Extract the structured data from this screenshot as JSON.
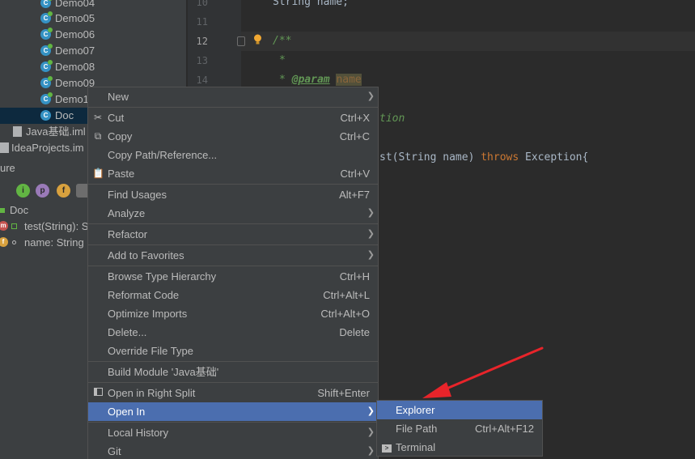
{
  "project_tree": {
    "items": [
      {
        "label": "Demo04",
        "type": "class"
      },
      {
        "label": "Demo05",
        "type": "class"
      },
      {
        "label": "Demo06",
        "type": "class"
      },
      {
        "label": "Demo07",
        "type": "class"
      },
      {
        "label": "Demo08",
        "type": "class"
      },
      {
        "label": "Demo09",
        "type": "class"
      },
      {
        "label": "Demo1",
        "type": "class"
      },
      {
        "label": "Doc",
        "type": "class"
      },
      {
        "label": "Java基础.iml",
        "type": "file"
      },
      {
        "label": "IdeaProjects.im",
        "type": "file"
      }
    ]
  },
  "structure": {
    "header": "ure",
    "root": "Doc",
    "members": [
      {
        "badge": "m",
        "label": "test(String): S"
      },
      {
        "badge": "f",
        "label": "name: String"
      }
    ],
    "toolbar_icons": [
      "i",
      "p",
      "f"
    ]
  },
  "editor": {
    "lines": [
      {
        "num": "10",
        "code": "String name;"
      },
      {
        "num": "11",
        "code": ""
      },
      {
        "num": "12",
        "code": "/**"
      },
      {
        "num": "13",
        "code": "*"
      },
      {
        "num": "14",
        "code_tag": "@param",
        "code_param": "name"
      }
    ],
    "fragment_exception": "tion",
    "fragment_method_prefix": "st(String name) ",
    "fragment_throws": "throws",
    "fragment_method_suffix": " Exception{"
  },
  "context_menu": {
    "items": [
      {
        "label": "New",
        "shortcut": "",
        "submenu": true
      },
      {
        "label": "Cut",
        "shortcut": "Ctrl+X",
        "icon": "scissors-icon"
      },
      {
        "label": "Copy",
        "shortcut": "Ctrl+C",
        "icon": "copy-icon"
      },
      {
        "label": "Copy Path/Reference...",
        "shortcut": ""
      },
      {
        "label": "Paste",
        "shortcut": "Ctrl+V",
        "icon": "paste-icon"
      },
      {
        "label": "Find Usages",
        "shortcut": "Alt+F7"
      },
      {
        "label": "Analyze",
        "shortcut": "",
        "submenu": true
      },
      {
        "label": "Refactor",
        "shortcut": "",
        "submenu": true
      },
      {
        "label": "Add to Favorites",
        "shortcut": "",
        "submenu": true
      },
      {
        "label": "Browse Type Hierarchy",
        "shortcut": "Ctrl+H"
      },
      {
        "label": "Reformat Code",
        "shortcut": "Ctrl+Alt+L"
      },
      {
        "label": "Optimize Imports",
        "shortcut": "Ctrl+Alt+O"
      },
      {
        "label": "Delete...",
        "shortcut": "Delete"
      },
      {
        "label": "Override File Type",
        "shortcut": ""
      },
      {
        "label": "Build Module 'Java基础'",
        "shortcut": ""
      },
      {
        "label": "Open in Right Split",
        "shortcut": "Shift+Enter",
        "icon": "split-icon"
      },
      {
        "label": "Open In",
        "shortcut": "",
        "submenu": true
      },
      {
        "label": "Local History",
        "shortcut": "",
        "submenu": true
      },
      {
        "label": "Git",
        "shortcut": "",
        "submenu": true
      }
    ]
  },
  "submenu_open_in": {
    "items": [
      {
        "label": "Explorer",
        "shortcut": ""
      },
      {
        "label": "File Path",
        "shortcut": "Ctrl+Alt+F12"
      },
      {
        "label": "Terminal",
        "shortcut": "",
        "icon": "terminal-icon"
      }
    ]
  },
  "colors": {
    "menu_highlight": "#4b6eaf",
    "annotation_arrow": "#e8242a"
  }
}
